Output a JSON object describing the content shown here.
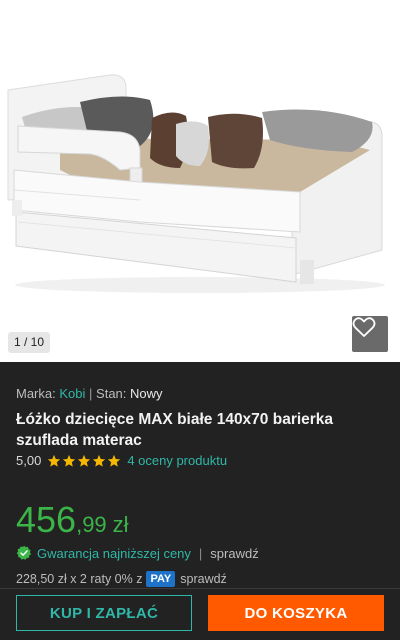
{
  "gallery": {
    "counter": "1 / 10",
    "favorite_icon": "heart-outline-icon"
  },
  "product": {
    "brand_label": "Marka:",
    "brand": "Kobi",
    "separator": "|",
    "condition_label": "Stan:",
    "condition": "Nowy",
    "title": "Łóżko dziecięce MAX białe 140x70 barierka szuflada materac",
    "rating_score": "5,00",
    "stars": 5,
    "rating_count": "4 oceny produktu"
  },
  "price": {
    "integer": "456",
    "decimal": ",99",
    "currency": "zł"
  },
  "guarantee": {
    "text": "Gwarancja najniższej ceny",
    "separator": "|",
    "check": "sprawdź"
  },
  "installments": {
    "text": "228,50 zł x 2 raty 0% z",
    "pay_badge": "PAY",
    "check": "sprawdź"
  },
  "actions": {
    "buy_now": "KUP I ZAPŁAĆ",
    "add_to_cart": "DO KOSZYKA"
  },
  "colors": {
    "accent": "#2fb8a8",
    "price": "#3bb548",
    "cart_button": "#ff5a00",
    "background": "#222222"
  }
}
